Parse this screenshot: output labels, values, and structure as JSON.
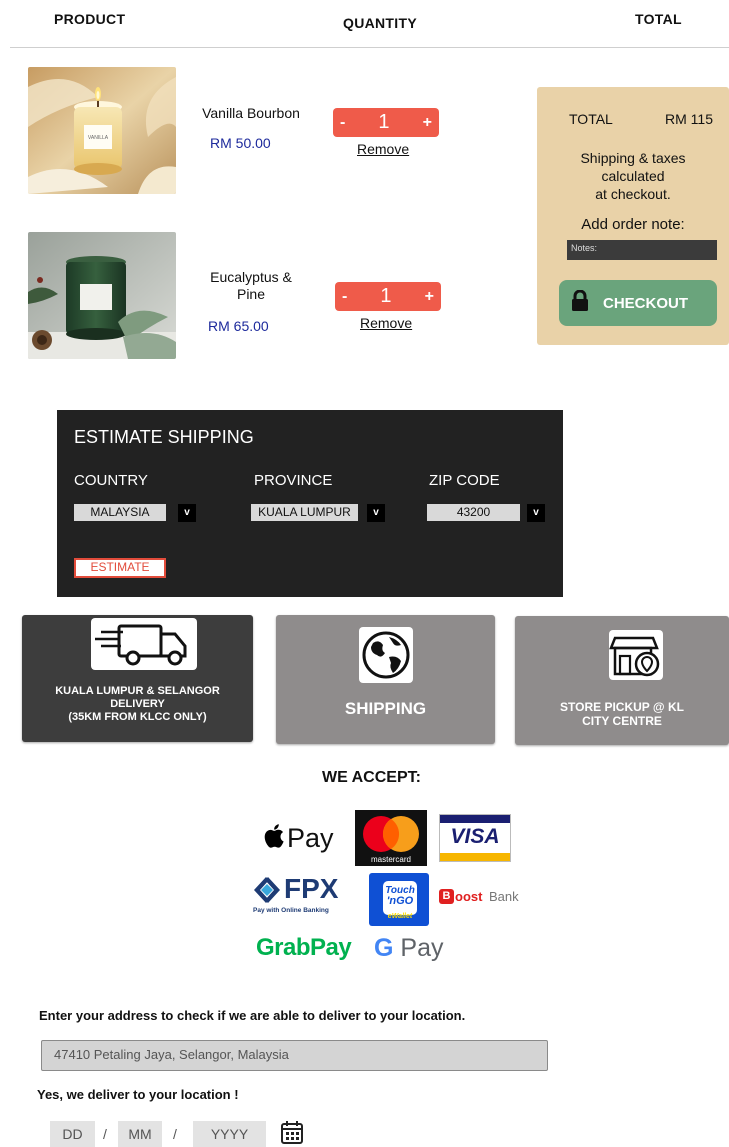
{
  "header": {
    "product": "PRODUCT",
    "quantity": "QUANTITY",
    "total": "TOTAL"
  },
  "cart": [
    {
      "name": "Vanilla Bourbon",
      "price": "RM 50.00",
      "qty_minus": "-",
      "qty": "1",
      "qty_plus": "+",
      "remove": "Remove",
      "label_text": "VANILLA"
    },
    {
      "name": "Eucalyptus &\nPine",
      "price": "RM 65.00",
      "qty_minus": "-",
      "qty": "1",
      "qty_plus": "+",
      "remove": "Remove"
    }
  ],
  "summary": {
    "total_label": "TOTAL",
    "total_value": "RM 115",
    "note": "Shipping & taxes calculated at checkout.",
    "note_lines": [
      "Shipping & taxes",
      "calculated",
      "at checkout."
    ],
    "order_note_label": "Add order note:",
    "notes_placeholder": "Notes:",
    "checkout": "CHECKOUT"
  },
  "estimate": {
    "title": "ESTIMATE SHIPPING",
    "country_label": "COUNTRY",
    "country_value": "MALAYSIA",
    "province_label": "PROVINCE",
    "province_value": "KUALA LUMPUR",
    "zip_label": "ZIP CODE",
    "zip_value": "43200",
    "caret": "v",
    "button": "ESTIMATE"
  },
  "delivery": [
    {
      "label": "KUALA LUMPUR & SELANGOR\nDELIVERY\n(35KM FROM KLCC ONLY)",
      "icon": "delivery-truck-icon"
    },
    {
      "label": "SHIPPING",
      "icon": "globe-icon"
    },
    {
      "label": "STORE PICKUP @ KL\nCITY CENTRE",
      "icon": "store-pin-icon"
    }
  ],
  "payments": {
    "title": "WE ACCEPT:",
    "apple_pay": "Pay",
    "mastercard": "mastercard",
    "visa": "VISA",
    "fpx": "FPX",
    "fpx_sub": "Pay with Online Banking",
    "tng_top": "Touch",
    "tng_mid": "'nGO",
    "tng_bottom": "eWallet",
    "boost": "oost",
    "boost_b": "B",
    "boost_bank": "Bank",
    "grab": "GrabPay",
    "gpay_g": "G",
    "gpay": "Pay"
  },
  "address": {
    "prompt": "Enter your address to check if we are able to deliver to your location.",
    "value": "47410 Petaling Jaya, Selangor, Malaysia",
    "result": "Yes, we deliver to your location !",
    "dd": "DD",
    "mm": "MM",
    "yyyy": "YYYY",
    "sep": "/"
  },
  "colors": {
    "qty_red": "#ef5b4a",
    "summary_bg": "#e9d2a8",
    "checkout_green": "#6aa47c",
    "price_blue": "#1d2a9c",
    "panel_dark": "#222222",
    "card_dark": "#3d3d3d",
    "card_grey": "#8f8c8c"
  }
}
